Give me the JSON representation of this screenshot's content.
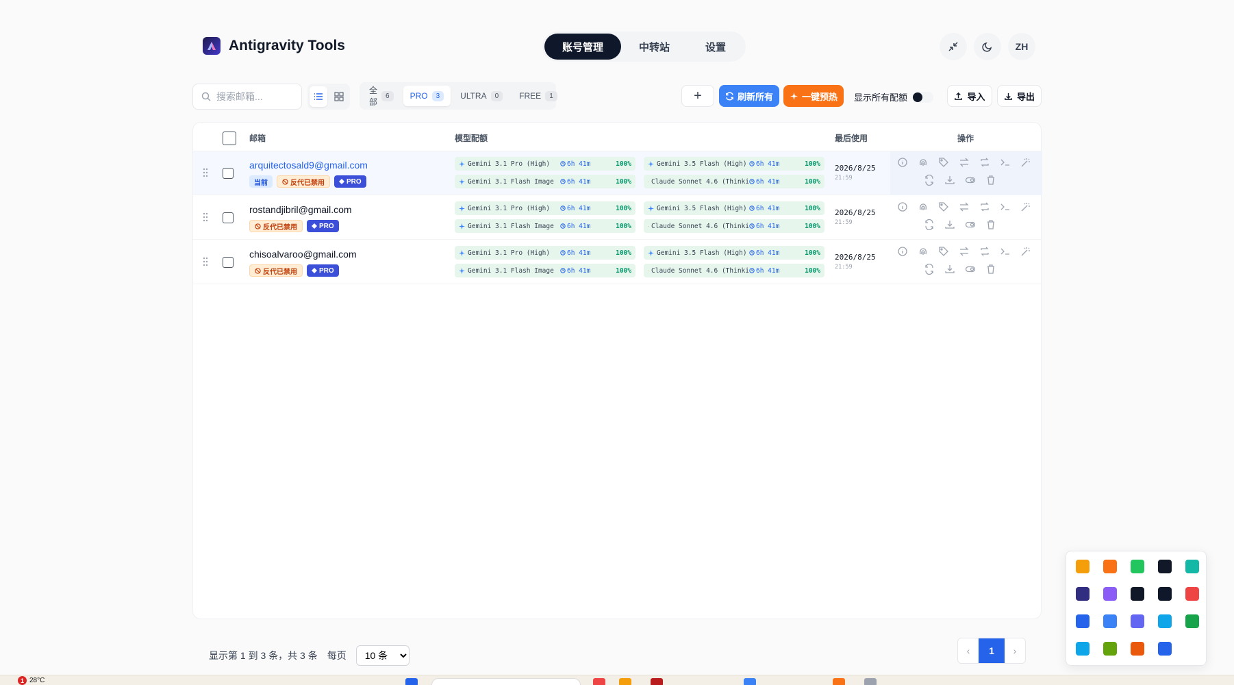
{
  "app": {
    "title": "Antigravity Tools"
  },
  "nav": {
    "tabs": [
      "账号管理",
      "中转站",
      "设置"
    ]
  },
  "header_buttons": {
    "lang": "ZH"
  },
  "toolbar": {
    "search_placeholder": "搜索邮箱...",
    "filters": [
      {
        "label": "全部",
        "count": "6"
      },
      {
        "label": "PRO",
        "count": "3"
      },
      {
        "label": "ULTRA",
        "count": "0"
      },
      {
        "label": "FREE",
        "count": "1"
      }
    ],
    "add_label": "+",
    "refresh_label": "刷新所有",
    "warmup_label": "一键预热",
    "show_all_quota_label": "显示所有配额",
    "import_label": "导入",
    "export_label": "导出"
  },
  "table": {
    "headers": {
      "email": "邮箱",
      "quota": "模型配额",
      "last_used": "最后使用",
      "actions": "操作"
    },
    "rows": [
      {
        "email": "arquitectosald9@gmail.com",
        "current": true,
        "badges": {
          "current": "当前",
          "banned": "反代已禁用",
          "tier": "PRO"
        },
        "quotas": [
          {
            "name": "Gemini 3.1 Pro (High)",
            "time": "6h 41m",
            "pct": "100%"
          },
          {
            "name": "Gemini 3.5 Flash (High)",
            "time": "6h 41m",
            "pct": "100%"
          },
          {
            "name": "Gemini 3.1 Flash Image",
            "time": "6h 41m",
            "pct": "100%"
          },
          {
            "name": "Claude Sonnet 4.6 (Thinki",
            "time": "6h 41m",
            "pct": "100%"
          }
        ],
        "last_used_date": "2026/8/25",
        "last_used_time": "21:59"
      },
      {
        "email": "rostandjibril@gmail.com",
        "current": false,
        "badges": {
          "current": "",
          "banned": "反代已禁用",
          "tier": "PRO"
        },
        "quotas": [
          {
            "name": "Gemini 3.1 Pro (High)",
            "time": "6h 41m",
            "pct": "100%"
          },
          {
            "name": "Gemini 3.5 Flash (High)",
            "time": "6h 41m",
            "pct": "100%"
          },
          {
            "name": "Gemini 3.1 Flash Image",
            "time": "6h 41m",
            "pct": "100%"
          },
          {
            "name": "Claude Sonnet 4.6 (Thinki",
            "time": "6h 41m",
            "pct": "100%"
          }
        ],
        "last_used_date": "2026/8/25",
        "last_used_time": "21:59"
      },
      {
        "email": "chisoalvaroo@gmail.com",
        "current": false,
        "badges": {
          "current": "",
          "banned": "反代已禁用",
          "tier": "PRO"
        },
        "quotas": [
          {
            "name": "Gemini 3.1 Pro (High)",
            "time": "6h 41m",
            "pct": "100%"
          },
          {
            "name": "Gemini 3.5 Flash (High)",
            "time": "6h 41m",
            "pct": "100%"
          },
          {
            "name": "Gemini 3.1 Flash Image",
            "time": "6h 41m",
            "pct": "100%"
          },
          {
            "name": "Claude Sonnet 4.6 (Thinki",
            "time": "6h 41m",
            "pct": "100%"
          }
        ],
        "last_used_date": "2026/8/25",
        "last_used_time": "21:59"
      }
    ]
  },
  "pagination": {
    "info": "显示第 1 到 3 条，共 3 条",
    "per_page_label": "每页",
    "per_page_value": "10 条",
    "current_page": "1"
  },
  "colors": {
    "accent": "#2563eb",
    "warm": "#f97316",
    "nav_active": "#0f172a",
    "quota_bg": "#e6f6ed",
    "quota_pct": "#059669"
  },
  "taskbar": {
    "weather": "28°C",
    "weather_badge": "1"
  }
}
